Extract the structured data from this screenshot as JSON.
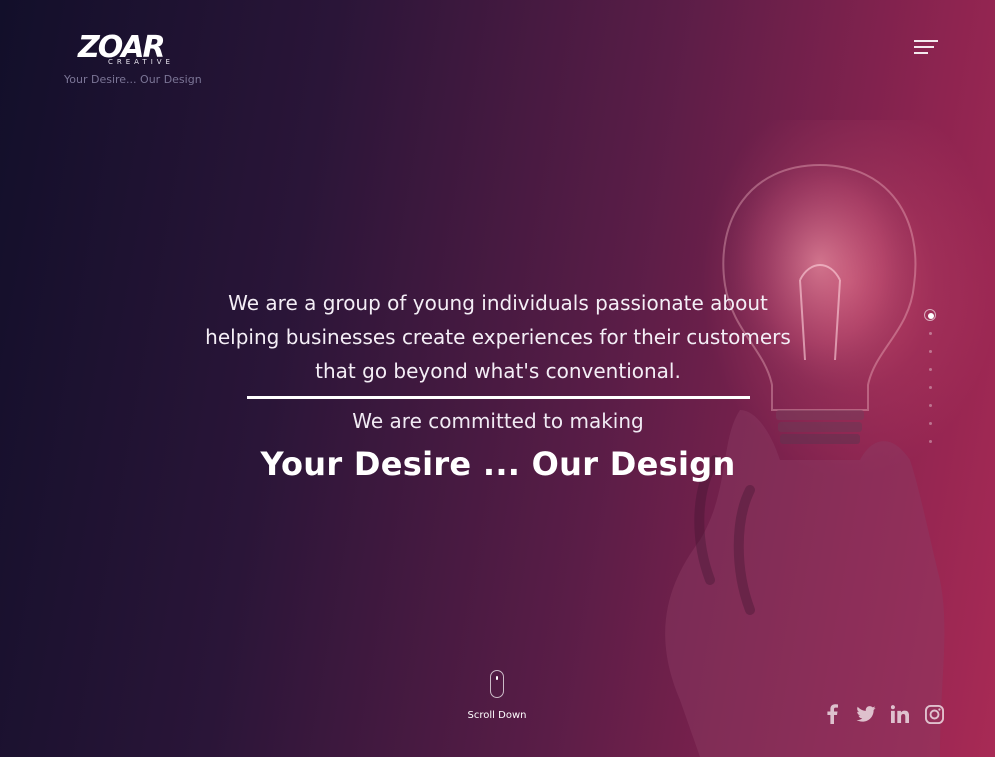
{
  "brand": {
    "logo_text": "ZOAR",
    "logo_subtext": "CREATIVE",
    "tagline": "Your Desire... Our Design"
  },
  "nav": {
    "menu_icon": "hamburger-icon"
  },
  "hero": {
    "lead": "We are a group of young individuals passionate about helping businesses create experiences for their customers that go beyond what's conventional.",
    "subheading": "We are committed to making",
    "title": "Your Desire ... Our Design"
  },
  "pagination": {
    "total": 8,
    "active_index": 1
  },
  "scroll": {
    "label": "Scroll Down"
  },
  "social": [
    "facebook-icon",
    "twitter-icon",
    "linkedin-icon",
    "instagram-icon"
  ],
  "colors": {
    "accent": "#a82a55",
    "background_dark": "#120f2a",
    "tagline": "#7b7596"
  }
}
